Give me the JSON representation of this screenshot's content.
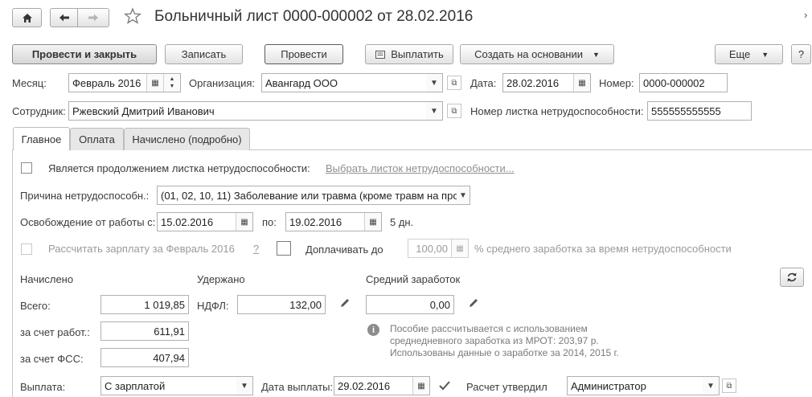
{
  "header": {
    "title": "Больничный лист 0000-000002 от 28.02.2016",
    "home_icon": "home-icon",
    "back_icon": "arrow-left-icon",
    "forward_icon": "arrow-right-icon",
    "star_icon": "star-icon"
  },
  "toolbar": {
    "post_close": "Провести и закрыть",
    "save": "Записать",
    "post": "Провести",
    "pay": "Выплатить",
    "create_based": "Создать на основании",
    "more": "Еще",
    "help": "?"
  },
  "form": {
    "month_label": "Месяц:",
    "month_value": "Февраль 2016",
    "org_label": "Организация:",
    "org_value": "Авангард ООО",
    "date_label": "Дата:",
    "date_value": "28.02.2016",
    "number_label": "Номер:",
    "number_value": "0000-000002",
    "employee_label": "Сотрудник:",
    "employee_value": "Ржевский Дмитрий Иванович",
    "sheet_number_label": "Номер листка нетрудоспособности:",
    "sheet_number_value": "555555555555"
  },
  "tabs": [
    {
      "label": "Главное",
      "active": true
    },
    {
      "label": "Оплата",
      "active": false
    },
    {
      "label": "Начислено (подробно)",
      "active": false
    }
  ],
  "main": {
    "continuation_label": "Является продолжением листка нетрудоспособности:",
    "continuation_link": "Выбрать листок нетрудоспособности...",
    "reason_label": "Причина нетрудоспособн.:",
    "reason_value": "(01, 02, 10, 11) Заболевание или травма (кроме травм на про",
    "release_label": "Освобождение от работы с:",
    "release_from": "15.02.2016",
    "release_to_label": "по:",
    "release_to": "19.02.2016",
    "days": "5 дн.",
    "calc_salary_label": "Рассчитать зарплату за Февраль 2016",
    "question": "?",
    "extra_pay_label": "Доплачивать до",
    "extra_pay_value": "100,00",
    "avg_earnings_pct_label": "% среднего заработка за время нетрудоспособности",
    "accrued_header": "Начислено",
    "withheld_header": "Удержано",
    "avg_header": "Средний заработок",
    "total_label": "Всего:",
    "total_value": "1 019,85",
    "ndfl_label": "НДФЛ:",
    "ndfl_value": "132,00",
    "avg_value": "0,00",
    "employer_label": "за счет работ.:",
    "employer_value": "611,91",
    "fss_label": "за счет ФСС:",
    "fss_value": "407,94",
    "info_line1": "Пособие рассчитывается с использованием",
    "info_line2": "среднедневного заработка из МРОТ: 203,97 р.",
    "info_line3": "Использованы данные о заработке за  2014,  2015 г.",
    "payout_label": "Выплата:",
    "payout_value": "С зарплатой",
    "payout_date_label": "Дата выплаты:",
    "payout_date_value": "29.02.2016",
    "approved_label": "Расчет утвердил",
    "approved_value": "Администратор"
  }
}
